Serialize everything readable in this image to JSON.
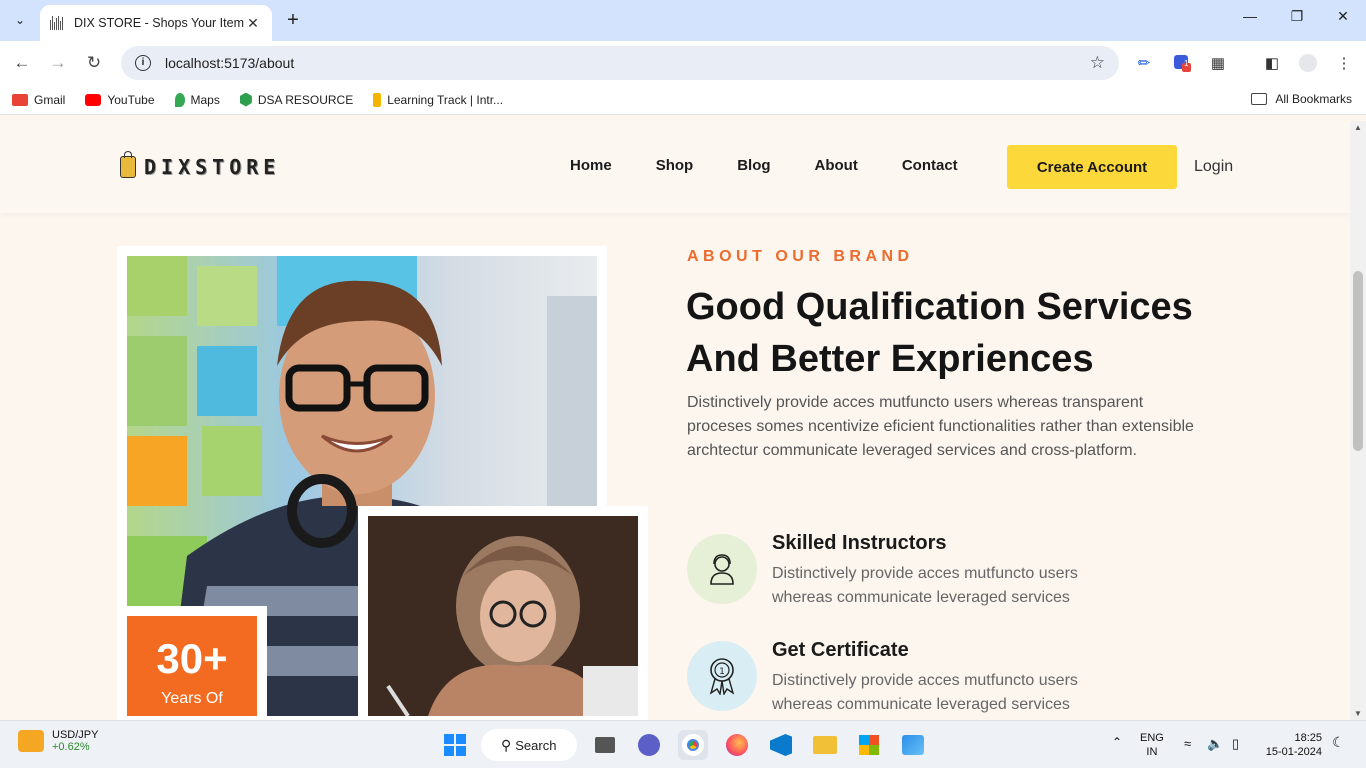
{
  "browser": {
    "tab_title": "DIX STORE - Shops Your Items",
    "url": "localhost:5173/about",
    "extension_badge": "1"
  },
  "bookmarks": [
    {
      "label": "Gmail",
      "color": "#ea4335"
    },
    {
      "label": "YouTube",
      "color": "#ff0000"
    },
    {
      "label": "Maps",
      "color": "#34a853"
    },
    {
      "label": "DSA RESOURCE",
      "color": "#2e9e4f"
    },
    {
      "label": "Learning Track | Intr...",
      "color": "#f4b400"
    }
  ],
  "all_bookmarks_label": "All Bookmarks",
  "site": {
    "logo_text": "DIXSTORE",
    "nav": [
      "Home",
      "Shop",
      "Blog",
      "About",
      "Contact"
    ],
    "create_account": "Create Account",
    "login": "Login"
  },
  "about": {
    "eyebrow": "ABOUT OUR BRAND",
    "headline": "Good Qualification Services And Better Expriences",
    "lead": "Distinctively provide acces mutfuncto users whereas transparent proceses somes ncentivize eficient functionalities rather than extensible archtectur communicate leveraged services and cross-platform.",
    "stat_number": "30+",
    "stat_label": "Years Of",
    "features": [
      {
        "title": "Skilled Instructors",
        "desc": "Distinctively provide acces mutfuncto users whereas communicate leveraged services",
        "icon": "instructor-icon",
        "bg": "#e6f0d6"
      },
      {
        "title": "Get Certificate",
        "desc": "Distinctively provide acces mutfuncto users whereas communicate leveraged services",
        "icon": "certificate-icon",
        "bg": "#d9eef4"
      }
    ]
  },
  "taskbar": {
    "ticker_pair": "USD/JPY",
    "ticker_change": "+0.62%",
    "search_label": "Search",
    "lang_line1": "ENG",
    "lang_line2": "IN",
    "time": "18:25",
    "date": "15-01-2024"
  }
}
